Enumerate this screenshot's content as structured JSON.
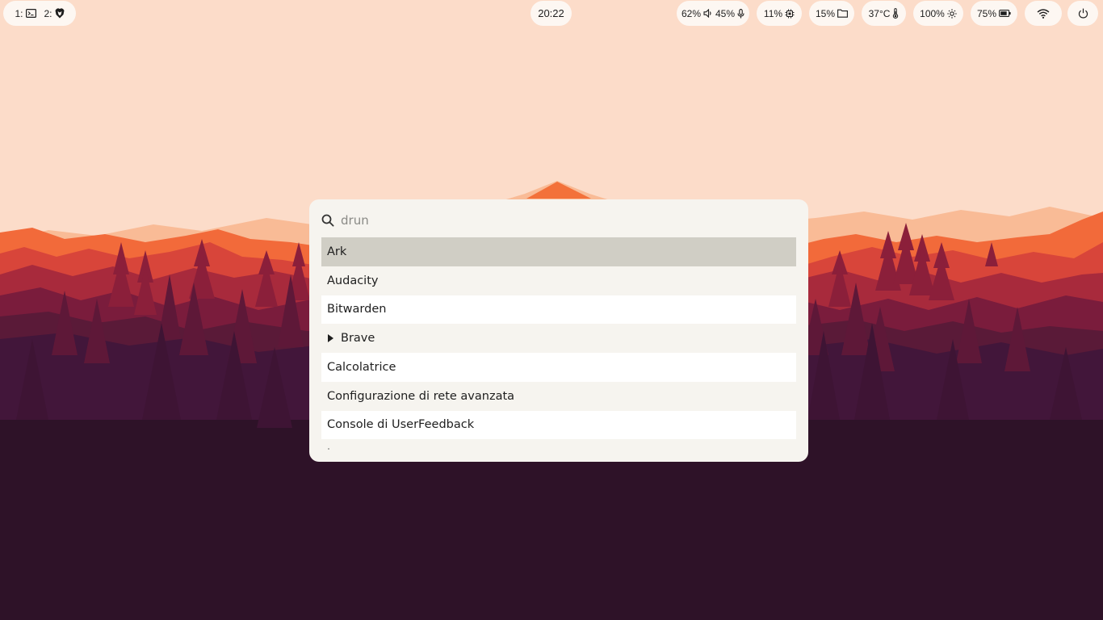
{
  "colors": {
    "sky": "#fcdcc9",
    "panel": "#fdf7f2",
    "launcher_bg": "#f6f4ef",
    "row_alt": "#ffffff",
    "row_selected": "#d0cec5",
    "ground": "#2e1228"
  },
  "topbar": {
    "workspaces": [
      {
        "label": "1:",
        "icon": "terminal-icon"
      },
      {
        "label": "2:",
        "icon": "brave-lion-icon"
      }
    ],
    "clock": "20:22",
    "volume": {
      "output": "62%",
      "input": "45%",
      "icons": [
        "speaker-icon",
        "microphone-icon"
      ]
    },
    "cpu": {
      "value": "11%",
      "icon": "cpu-chip-icon"
    },
    "disk": {
      "value": "15%",
      "icon": "folder-icon"
    },
    "temperature": {
      "value": "37°C",
      "icon": "thermometer-icon"
    },
    "brightness": {
      "value": "100%",
      "icon": "sun-icon"
    },
    "battery": {
      "value": "75%",
      "icon": "battery-icon"
    },
    "network": {
      "icon": "wifi-icon"
    },
    "power": {
      "icon": "power-icon"
    }
  },
  "launcher": {
    "search_placeholder": "drun",
    "search_value": "",
    "items": [
      {
        "label": "Ark",
        "selected": true
      },
      {
        "label": "Audacity"
      },
      {
        "label": "Bitwarden"
      },
      {
        "label": "Brave",
        "expandable": true
      },
      {
        "label": "Calcolatrice"
      },
      {
        "label": "Configurazione di rete avanzata"
      },
      {
        "label": "Console di UserFeedback"
      }
    ]
  }
}
